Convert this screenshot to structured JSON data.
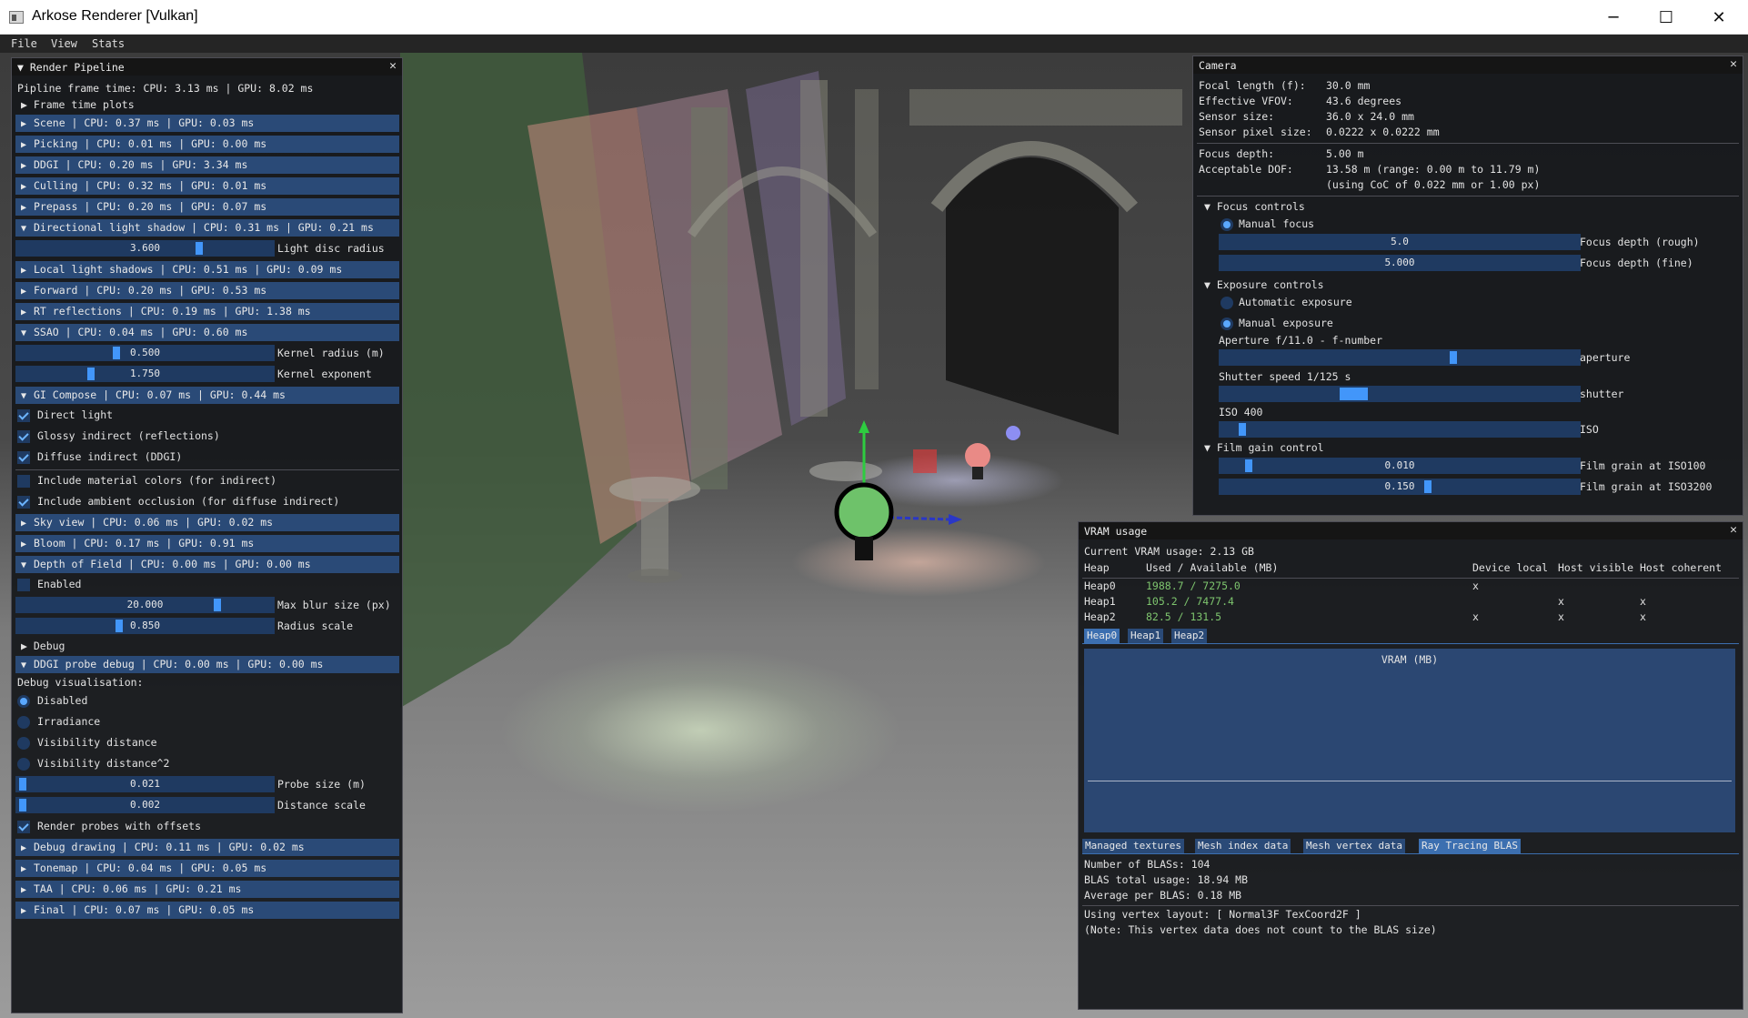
{
  "window": {
    "title": "Arkose Renderer [Vulkan]",
    "minimize": "─",
    "maximize": "☐",
    "close": "✕"
  },
  "menu": [
    "File",
    "View",
    "Stats"
  ],
  "render_pipeline": {
    "title": "Render Pipeline",
    "frame_time": "Pipline frame time: CPU: 3.13 ms | GPU: 8.02 ms",
    "frame_time_plots": "Frame time plots",
    "sections": [
      "Scene | CPU: 0.37 ms | GPU: 0.03 ms",
      "Picking | CPU: 0.01 ms | GPU: 0.00 ms",
      "DDGI | CPU: 0.20 ms | GPU: 3.34 ms",
      "Culling | CPU: 0.32 ms | GPU: 0.01 ms",
      "Prepass | CPU: 0.20 ms | GPU: 0.07 ms",
      "Directional light shadow | CPU: 0.31 ms | GPU: 0.21 ms",
      "Local light shadows | CPU: 0.51 ms | GPU: 0.09 ms",
      "Forward | CPU: 0.20 ms | GPU: 0.53 ms",
      "RT reflections | CPU: 0.19 ms | GPU: 1.38 ms",
      "SSAO | CPU: 0.04 ms | GPU: 0.60 ms",
      "GI Compose | CPU: 0.07 ms | GPU: 0.44 ms",
      "Sky view | CPU: 0.06 ms | GPU: 0.02 ms",
      "Bloom | CPU: 0.17 ms | GPU: 0.91 ms",
      "Depth of Field | CPU: 0.00 ms | GPU: 0.00 ms",
      "DDGI probe debug | CPU: 0.00 ms | GPU: 0.00 ms",
      "Debug drawing | CPU: 0.11 ms | GPU: 0.02 ms",
      "Tonemap | CPU: 0.04 ms | GPU: 0.05 ms",
      "TAA | CPU: 0.06 ms | GPU: 0.21 ms",
      "Final | CPU: 0.07 ms | GPU: 0.05 ms"
    ],
    "sliders": [
      {
        "value": "3.600",
        "label": "Light disc radius"
      },
      {
        "value": "0.500",
        "label": "Kernel radius (m)"
      },
      {
        "value": "1.750",
        "label": "Kernel exponent"
      },
      {
        "value": "20.000",
        "label": "Max blur size (px)"
      },
      {
        "value": "0.850",
        "label": "Radius scale"
      },
      {
        "value": "0.021",
        "label": "Probe size (m)"
      },
      {
        "value": "0.002",
        "label": "Distance scale"
      }
    ],
    "checks": [
      "Direct light",
      "Glossy indirect (reflections)",
      "Diffuse indirect (DDGI)",
      "Include material colors (for indirect)",
      "Include ambient occlusion (for diffuse indirect)",
      "Enabled",
      "Render probes with offsets"
    ],
    "debug_label": "Debug",
    "debug_vis_label": "Debug visualisation:",
    "radios": [
      "Disabled",
      "Irradiance",
      "Visibility distance",
      "Visibility distance^2"
    ]
  },
  "camera": {
    "title": "Camera",
    "rows": [
      {
        "k": "Focal length (f):",
        "v": "30.0 mm"
      },
      {
        "k": "Effective VFOV:",
        "v": "43.6 degrees"
      },
      {
        "k": "Sensor size:",
        "v": "36.0 x 24.0 mm"
      },
      {
        "k": "Sensor pixel size:",
        "v": "0.0222 x 0.0222 mm"
      },
      {
        "k": "Focus depth:",
        "v": "5.00 m"
      },
      {
        "k": "Acceptable DOF:",
        "v": "13.58 m (range: 0.00 m to 11.79 m)"
      },
      {
        "k": "",
        "v": "(using CoC of 0.022 mm or 1.00 px)"
      }
    ],
    "focus_controls": "Focus controls",
    "manual_focus": "Manual focus",
    "focus_rough": {
      "value": "5.0",
      "label": "Focus depth (rough)"
    },
    "focus_fine": {
      "value": "5.000",
      "label": "Focus depth (fine)"
    },
    "exposure_controls": "Exposure controls",
    "auto_exposure": "Automatic exposure",
    "manual_exposure": "Manual exposure",
    "aperture_text": "Aperture f/11.0 - f-number",
    "aperture_label": "aperture",
    "shutter_text": "Shutter speed  1/125 s",
    "shutter_label": "shutter",
    "iso_text": "ISO 400",
    "iso_label": "ISO",
    "film_gain": "Film gain control",
    "grain100": {
      "value": "0.010",
      "label": "Film grain at ISO100"
    },
    "grain3200": {
      "value": "0.150",
      "label": "Film grain at ISO3200"
    }
  },
  "vram": {
    "title": "VRAM usage",
    "current": "Current VRAM usage: 2.13 GB",
    "headers": [
      "Heap",
      "Used / Available (MB)",
      "Device local",
      "Host visible",
      "Host coherent"
    ],
    "heaps": [
      {
        "name": "Heap0",
        "used": "1988.7 / 7275.0",
        "dl": "x",
        "hv": "",
        "hc": ""
      },
      {
        "name": "Heap1",
        "used": "105.2 / 7477.4",
        "dl": "",
        "hv": "x",
        "hc": "x"
      },
      {
        "name": "Heap2",
        "used": "82.5 / 131.5",
        "dl": "x",
        "hv": "x",
        "hc": "x"
      }
    ],
    "heap_tabs": [
      "Heap0",
      "Heap1",
      "Heap2"
    ],
    "plot_title": "VRAM (MB)",
    "data_tabs": [
      "Managed textures",
      "Mesh index data",
      "Mesh vertex data",
      "Ray Tracing BLAS"
    ],
    "info": [
      "Number of BLASs: 104",
      "BLAS total usage: 18.94 MB",
      "Average per BLAS: 0.18 MB"
    ],
    "layout": "Using vertex layout: [ Normal3F TexCoord2F ]",
    "note": "(Note: This vertex data does not count to the BLAS size)"
  }
}
